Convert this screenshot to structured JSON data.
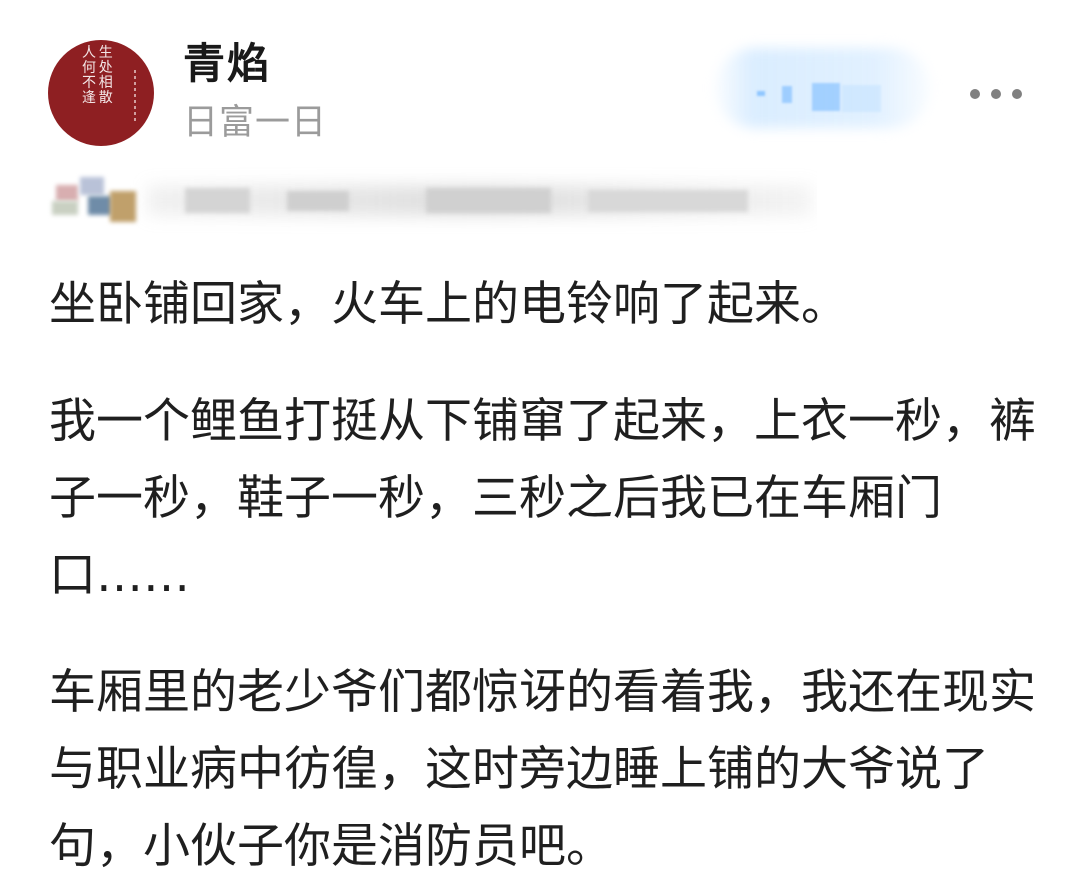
{
  "header": {
    "avatar_text": "人 生\n何 处\n不 相\n逢 散",
    "username": "青焰",
    "subtitle": "日富一日",
    "more_icon": "more-horizontal-icon"
  },
  "post": {
    "paragraphs": [
      "坐卧铺回家，火车上的电铃响了起来。",
      "我一个鲤鱼打挺从下铺窜了起来，上衣一秒，裤子一秒，鞋子一秒，三秒之后我已在车厢门口……",
      "车厢里的老少爷们都惊讶的看着我，我还在现实与职业病中彷徨，这时旁边睡上铺的大爷说了句，小伙子你是消防员吧。"
    ]
  },
  "colors": {
    "background": "#ffffff",
    "avatar": "#8e1f22",
    "muted_text": "#9b9b9b",
    "body_text": "#1f1f1f",
    "follow_blur": "#d8ecff"
  }
}
